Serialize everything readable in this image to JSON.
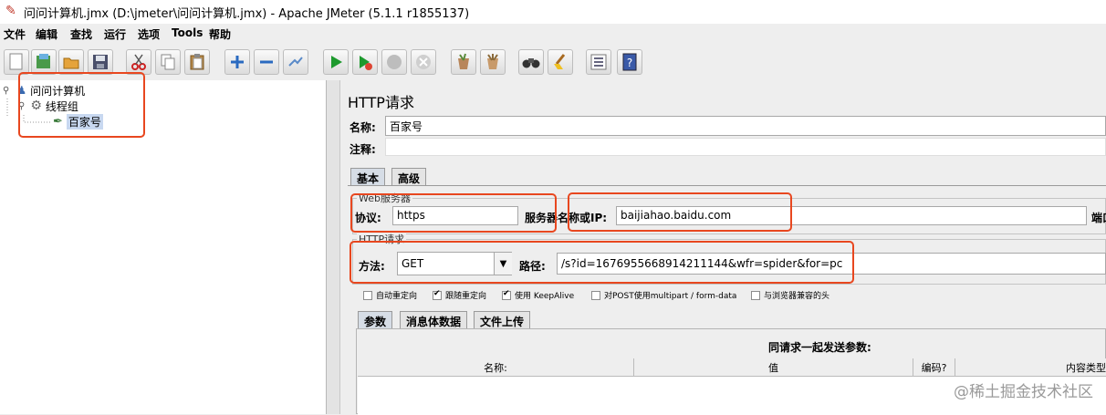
{
  "window": {
    "title": "问问计算机.jmx (D:\\jmeter\\问问计算机.jmx) - Apache JMeter (5.1.1 r1855137)"
  },
  "menu": {
    "items": [
      "文件",
      "编辑",
      "查找",
      "运行",
      "选项",
      "Tools",
      "帮助"
    ]
  },
  "toolbar": {
    "buttons": [
      "new-icon",
      "templates-icon",
      "open-icon",
      "save-icon",
      "cut-icon",
      "copy-icon",
      "paste-icon",
      "expand-icon",
      "collapse-icon",
      "toggle-icon",
      "start-icon",
      "start-no-pause-icon",
      "stop-icon",
      "shutdown-icon",
      "clear-icon",
      "clear-all-icon",
      "search-icon",
      "reset-search-icon",
      "function-helper-icon",
      "help-icon"
    ]
  },
  "tree": {
    "nodes": [
      {
        "label": "问问计算机",
        "icon": "test-plan-icon"
      },
      {
        "label": "线程组",
        "icon": "thread-group-icon"
      },
      {
        "label": "百家号",
        "icon": "sampler-pen-icon",
        "selected": true
      }
    ]
  },
  "panel": {
    "title": "HTTP请求",
    "name_label": "名称:",
    "name_value": "百家号",
    "comment_label": "注释:",
    "tabs": [
      "基本",
      "高级"
    ],
    "web_server_group": "Web服务器",
    "protocol_label": "协议:",
    "protocol_value": "https",
    "server_label": "服务器名称或IP:",
    "server_value": "baijiahao.baidu.com",
    "port_label_partial": "端口",
    "http_request_group": "HTTP请求",
    "method_label": "方法:",
    "method_value": "GET",
    "path_label": "路径:",
    "path_value": "/s?id=1676955668914211144&wfr=spider&for=pc",
    "checkboxes": [
      {
        "label": "自动重定向",
        "checked": false
      },
      {
        "label": "跟随重定向",
        "checked": true
      },
      {
        "label": "使用 KeepAlive",
        "checked": true
      },
      {
        "label": "对POST使用multipart / form-data",
        "checked": false
      },
      {
        "label": "与浏览器兼容的头",
        "checked": false
      }
    ],
    "param_tabs": [
      "参数",
      "消息体数据",
      "文件上传"
    ],
    "params_caption": "同请求一起发送参数:",
    "columns": [
      "名称:",
      "值",
      "编码?",
      "内容类型"
    ]
  },
  "colors": {
    "highlight": "#e8471f",
    "selected_node": "#c8d8f0"
  },
  "watermark": "@稀土掘金技术社区"
}
